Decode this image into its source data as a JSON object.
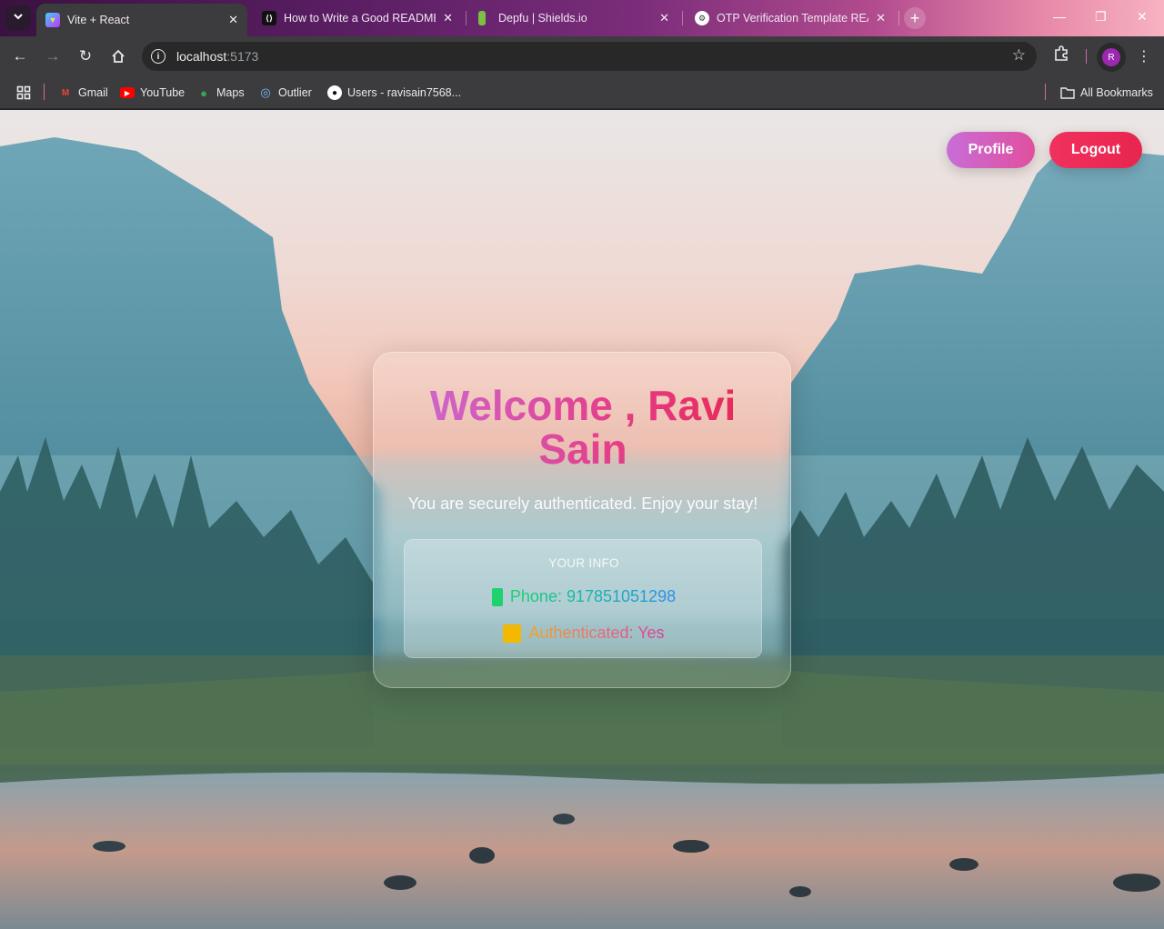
{
  "browser": {
    "tabs": [
      {
        "title": "Vite + React",
        "favicon": "vite-icon",
        "active": true
      },
      {
        "title": "How to Write a Good README",
        "favicon": "daily-dev-icon",
        "active": false
      },
      {
        "title": "Depfu | Shields.io",
        "favicon": "shields-icon",
        "active": false
      },
      {
        "title": "OTP Verification Template READ",
        "favicon": "chatgpt-icon",
        "active": false
      }
    ],
    "address": {
      "host": "localhost",
      "port": ":5173"
    },
    "bookmarks": [
      {
        "label": "Gmail",
        "icon": "gmail-icon"
      },
      {
        "label": "YouTube",
        "icon": "youtube-icon"
      },
      {
        "label": "Maps",
        "icon": "maps-icon"
      },
      {
        "label": "Outlier",
        "icon": "outlier-icon"
      },
      {
        "label": "Users - ravisain7568...",
        "icon": "github-icon"
      }
    ],
    "all_bookmarks_label": "All Bookmarks",
    "profile_initial": "R"
  },
  "nav": {
    "profile_label": "Profile",
    "logout_label": "Logout"
  },
  "card": {
    "welcome": "Welcome , Ravi Sain",
    "subtitle": "You are securely authenticated. Enjoy your stay!",
    "info_title": "YOUR INFO",
    "phone_label": "Phone: 917851051298",
    "auth_label": "Authenticated: Yes"
  },
  "colors": {
    "profile_gradient": [
      "#c86dd7",
      "#e0509e"
    ],
    "logout_color": "#e8254d",
    "phone_emoji": "#1ed26e",
    "auth_emoji": "#f5b800"
  }
}
